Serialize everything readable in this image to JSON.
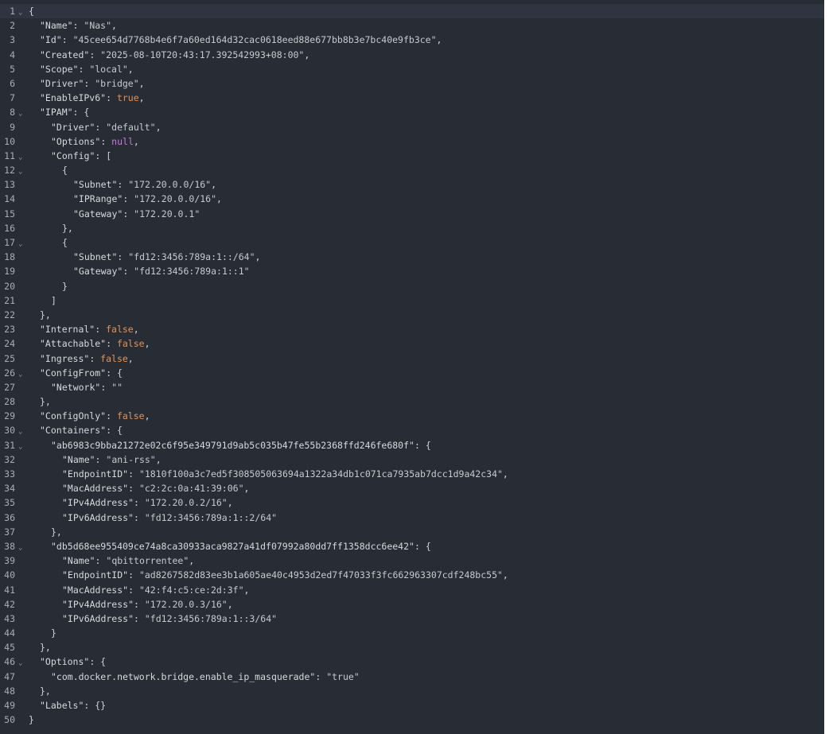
{
  "colors": {
    "background": "#272c35",
    "active_line": "#2f3440",
    "line_number": "#a8aeb8",
    "text": "#d4d7dd",
    "boolean": "#e2935a",
    "null": "#c679dd"
  },
  "fold_icon": "chevron-down-icon",
  "lines": [
    {
      "n": "1",
      "indent": 0,
      "fold": true,
      "tokens": [
        {
          "t": "punc",
          "v": "{"
        }
      ]
    },
    {
      "n": "2",
      "indent": 1,
      "tokens": [
        {
          "t": "key",
          "v": "\"Name\""
        },
        {
          "t": "punc",
          "v": ": "
        },
        {
          "t": "str",
          "v": "\"Nas\""
        },
        {
          "t": "punc",
          "v": ","
        }
      ]
    },
    {
      "n": "3",
      "indent": 1,
      "tokens": [
        {
          "t": "key",
          "v": "\"Id\""
        },
        {
          "t": "punc",
          "v": ": "
        },
        {
          "t": "str",
          "v": "\"45cee654d7768b4e6f7a60ed164d32cac0618eed88e677bb8b3e7bc40e9fb3ce\""
        },
        {
          "t": "punc",
          "v": ","
        }
      ]
    },
    {
      "n": "4",
      "indent": 1,
      "tokens": [
        {
          "t": "key",
          "v": "\"Created\""
        },
        {
          "t": "punc",
          "v": ": "
        },
        {
          "t": "str",
          "v": "\"2025-08-10T20:43:17.392542993+08:00\""
        },
        {
          "t": "punc",
          "v": ","
        }
      ]
    },
    {
      "n": "5",
      "indent": 1,
      "tokens": [
        {
          "t": "key",
          "v": "\"Scope\""
        },
        {
          "t": "punc",
          "v": ": "
        },
        {
          "t": "str",
          "v": "\"local\""
        },
        {
          "t": "punc",
          "v": ","
        }
      ]
    },
    {
      "n": "6",
      "indent": 1,
      "tokens": [
        {
          "t": "key",
          "v": "\"Driver\""
        },
        {
          "t": "punc",
          "v": ": "
        },
        {
          "t": "str",
          "v": "\"bridge\""
        },
        {
          "t": "punc",
          "v": ","
        }
      ]
    },
    {
      "n": "7",
      "indent": 1,
      "tokens": [
        {
          "t": "key",
          "v": "\"EnableIPv6\""
        },
        {
          "t": "punc",
          "v": ": "
        },
        {
          "t": "bool",
          "v": "true"
        },
        {
          "t": "punc",
          "v": ","
        }
      ]
    },
    {
      "n": "8",
      "indent": 1,
      "fold": true,
      "tokens": [
        {
          "t": "key",
          "v": "\"IPAM\""
        },
        {
          "t": "punc",
          "v": ": {"
        }
      ]
    },
    {
      "n": "9",
      "indent": 2,
      "tokens": [
        {
          "t": "key",
          "v": "\"Driver\""
        },
        {
          "t": "punc",
          "v": ": "
        },
        {
          "t": "str",
          "v": "\"default\""
        },
        {
          "t": "punc",
          "v": ","
        }
      ]
    },
    {
      "n": "10",
      "indent": 2,
      "tokens": [
        {
          "t": "key",
          "v": "\"Options\""
        },
        {
          "t": "punc",
          "v": ": "
        },
        {
          "t": "null",
          "v": "null"
        },
        {
          "t": "punc",
          "v": ","
        }
      ]
    },
    {
      "n": "11",
      "indent": 2,
      "fold": true,
      "tokens": [
        {
          "t": "key",
          "v": "\"Config\""
        },
        {
          "t": "punc",
          "v": ": ["
        }
      ]
    },
    {
      "n": "12",
      "indent": 3,
      "fold": true,
      "tokens": [
        {
          "t": "punc",
          "v": "{"
        }
      ]
    },
    {
      "n": "13",
      "indent": 4,
      "tokens": [
        {
          "t": "key",
          "v": "\"Subnet\""
        },
        {
          "t": "punc",
          "v": ": "
        },
        {
          "t": "str",
          "v": "\"172.20.0.0/16\""
        },
        {
          "t": "punc",
          "v": ","
        }
      ]
    },
    {
      "n": "14",
      "indent": 4,
      "tokens": [
        {
          "t": "key",
          "v": "\"IPRange\""
        },
        {
          "t": "punc",
          "v": ": "
        },
        {
          "t": "str",
          "v": "\"172.20.0.0/16\""
        },
        {
          "t": "punc",
          "v": ","
        }
      ]
    },
    {
      "n": "15",
      "indent": 4,
      "tokens": [
        {
          "t": "key",
          "v": "\"Gateway\""
        },
        {
          "t": "punc",
          "v": ": "
        },
        {
          "t": "str",
          "v": "\"172.20.0.1\""
        }
      ]
    },
    {
      "n": "16",
      "indent": 3,
      "tokens": [
        {
          "t": "punc",
          "v": "},"
        }
      ]
    },
    {
      "n": "17",
      "indent": 3,
      "fold": true,
      "tokens": [
        {
          "t": "punc",
          "v": "{"
        }
      ]
    },
    {
      "n": "18",
      "indent": 4,
      "tokens": [
        {
          "t": "key",
          "v": "\"Subnet\""
        },
        {
          "t": "punc",
          "v": ": "
        },
        {
          "t": "str",
          "v": "\"fd12:3456:789a:1::/64\""
        },
        {
          "t": "punc",
          "v": ","
        }
      ]
    },
    {
      "n": "19",
      "indent": 4,
      "tokens": [
        {
          "t": "key",
          "v": "\"Gateway\""
        },
        {
          "t": "punc",
          "v": ": "
        },
        {
          "t": "str",
          "v": "\"fd12:3456:789a:1::1\""
        }
      ]
    },
    {
      "n": "20",
      "indent": 3,
      "tokens": [
        {
          "t": "punc",
          "v": "}"
        }
      ]
    },
    {
      "n": "21",
      "indent": 2,
      "tokens": [
        {
          "t": "punc",
          "v": "]"
        }
      ]
    },
    {
      "n": "22",
      "indent": 1,
      "tokens": [
        {
          "t": "punc",
          "v": "},"
        }
      ]
    },
    {
      "n": "23",
      "indent": 1,
      "tokens": [
        {
          "t": "key",
          "v": "\"Internal\""
        },
        {
          "t": "punc",
          "v": ": "
        },
        {
          "t": "bool",
          "v": "false"
        },
        {
          "t": "punc",
          "v": ","
        }
      ]
    },
    {
      "n": "24",
      "indent": 1,
      "tokens": [
        {
          "t": "key",
          "v": "\"Attachable\""
        },
        {
          "t": "punc",
          "v": ": "
        },
        {
          "t": "bool",
          "v": "false"
        },
        {
          "t": "punc",
          "v": ","
        }
      ]
    },
    {
      "n": "25",
      "indent": 1,
      "tokens": [
        {
          "t": "key",
          "v": "\"Ingress\""
        },
        {
          "t": "punc",
          "v": ": "
        },
        {
          "t": "bool",
          "v": "false"
        },
        {
          "t": "punc",
          "v": ","
        }
      ]
    },
    {
      "n": "26",
      "indent": 1,
      "fold": true,
      "tokens": [
        {
          "t": "key",
          "v": "\"ConfigFrom\""
        },
        {
          "t": "punc",
          "v": ": {"
        }
      ]
    },
    {
      "n": "27",
      "indent": 2,
      "tokens": [
        {
          "t": "key",
          "v": "\"Network\""
        },
        {
          "t": "punc",
          "v": ": "
        },
        {
          "t": "str",
          "v": "\"\""
        }
      ]
    },
    {
      "n": "28",
      "indent": 1,
      "tokens": [
        {
          "t": "punc",
          "v": "},"
        }
      ]
    },
    {
      "n": "29",
      "indent": 1,
      "tokens": [
        {
          "t": "key",
          "v": "\"ConfigOnly\""
        },
        {
          "t": "punc",
          "v": ": "
        },
        {
          "t": "bool",
          "v": "false"
        },
        {
          "t": "punc",
          "v": ","
        }
      ]
    },
    {
      "n": "30",
      "indent": 1,
      "fold": true,
      "tokens": [
        {
          "t": "key",
          "v": "\"Containers\""
        },
        {
          "t": "punc",
          "v": ": {"
        }
      ]
    },
    {
      "n": "31",
      "indent": 2,
      "fold": true,
      "tokens": [
        {
          "t": "key",
          "v": "\"ab6983c9bba21272e02c6f95e349791d9ab5c035b47fe55b2368ffd246fe680f\""
        },
        {
          "t": "punc",
          "v": ": {"
        }
      ]
    },
    {
      "n": "32",
      "indent": 3,
      "tokens": [
        {
          "t": "key",
          "v": "\"Name\""
        },
        {
          "t": "punc",
          "v": ": "
        },
        {
          "t": "str",
          "v": "\"ani-rss\""
        },
        {
          "t": "punc",
          "v": ","
        }
      ]
    },
    {
      "n": "33",
      "indent": 3,
      "tokens": [
        {
          "t": "key",
          "v": "\"EndpointID\""
        },
        {
          "t": "punc",
          "v": ": "
        },
        {
          "t": "str",
          "v": "\"1810f100a3c7ed5f308505063694a1322a34db1c071ca7935ab7dcc1d9a42c34\""
        },
        {
          "t": "punc",
          "v": ","
        }
      ]
    },
    {
      "n": "34",
      "indent": 3,
      "tokens": [
        {
          "t": "key",
          "v": "\"MacAddress\""
        },
        {
          "t": "punc",
          "v": ": "
        },
        {
          "t": "str",
          "v": "\"c2:2c:0a:41:39:06\""
        },
        {
          "t": "punc",
          "v": ","
        }
      ]
    },
    {
      "n": "35",
      "indent": 3,
      "tokens": [
        {
          "t": "key",
          "v": "\"IPv4Address\""
        },
        {
          "t": "punc",
          "v": ": "
        },
        {
          "t": "str",
          "v": "\"172.20.0.2/16\""
        },
        {
          "t": "punc",
          "v": ","
        }
      ]
    },
    {
      "n": "36",
      "indent": 3,
      "tokens": [
        {
          "t": "key",
          "v": "\"IPv6Address\""
        },
        {
          "t": "punc",
          "v": ": "
        },
        {
          "t": "str",
          "v": "\"fd12:3456:789a:1::2/64\""
        }
      ]
    },
    {
      "n": "37",
      "indent": 2,
      "tokens": [
        {
          "t": "punc",
          "v": "},"
        }
      ]
    },
    {
      "n": "38",
      "indent": 2,
      "fold": true,
      "tokens": [
        {
          "t": "key",
          "v": "\"db5d68ee955409ce74a8ca30933aca9827a41df07992a80dd7ff1358dcc6ee42\""
        },
        {
          "t": "punc",
          "v": ": {"
        }
      ]
    },
    {
      "n": "39",
      "indent": 3,
      "tokens": [
        {
          "t": "key",
          "v": "\"Name\""
        },
        {
          "t": "punc",
          "v": ": "
        },
        {
          "t": "str",
          "v": "\"qbittorrentee\""
        },
        {
          "t": "punc",
          "v": ","
        }
      ]
    },
    {
      "n": "40",
      "indent": 3,
      "tokens": [
        {
          "t": "key",
          "v": "\"EndpointID\""
        },
        {
          "t": "punc",
          "v": ": "
        },
        {
          "t": "str",
          "v": "\"ad8267582d83ee3b1a605ae40c4953d2ed7f47033f3fc662963307cdf248bc55\""
        },
        {
          "t": "punc",
          "v": ","
        }
      ]
    },
    {
      "n": "41",
      "indent": 3,
      "tokens": [
        {
          "t": "key",
          "v": "\"MacAddress\""
        },
        {
          "t": "punc",
          "v": ": "
        },
        {
          "t": "str",
          "v": "\"42:f4:c5:ce:2d:3f\""
        },
        {
          "t": "punc",
          "v": ","
        }
      ]
    },
    {
      "n": "42",
      "indent": 3,
      "tokens": [
        {
          "t": "key",
          "v": "\"IPv4Address\""
        },
        {
          "t": "punc",
          "v": ": "
        },
        {
          "t": "str",
          "v": "\"172.20.0.3/16\""
        },
        {
          "t": "punc",
          "v": ","
        }
      ]
    },
    {
      "n": "43",
      "indent": 3,
      "tokens": [
        {
          "t": "key",
          "v": "\"IPv6Address\""
        },
        {
          "t": "punc",
          "v": ": "
        },
        {
          "t": "str",
          "v": "\"fd12:3456:789a:1::3/64\""
        }
      ]
    },
    {
      "n": "44",
      "indent": 2,
      "tokens": [
        {
          "t": "punc",
          "v": "}"
        }
      ]
    },
    {
      "n": "45",
      "indent": 1,
      "tokens": [
        {
          "t": "punc",
          "v": "},"
        }
      ]
    },
    {
      "n": "46",
      "indent": 1,
      "fold": true,
      "tokens": [
        {
          "t": "key",
          "v": "\"Options\""
        },
        {
          "t": "punc",
          "v": ": {"
        }
      ]
    },
    {
      "n": "47",
      "indent": 2,
      "tokens": [
        {
          "t": "key",
          "v": "\"com.docker.network.bridge.enable_ip_masquerade\""
        },
        {
          "t": "punc",
          "v": ": "
        },
        {
          "t": "str",
          "v": "\"true\""
        }
      ]
    },
    {
      "n": "48",
      "indent": 1,
      "tokens": [
        {
          "t": "punc",
          "v": "},"
        }
      ]
    },
    {
      "n": "49",
      "indent": 1,
      "tokens": [
        {
          "t": "key",
          "v": "\"Labels\""
        },
        {
          "t": "punc",
          "v": ": {}"
        }
      ]
    },
    {
      "n": "50",
      "indent": 0,
      "tokens": [
        {
          "t": "punc",
          "v": "}"
        }
      ]
    }
  ]
}
